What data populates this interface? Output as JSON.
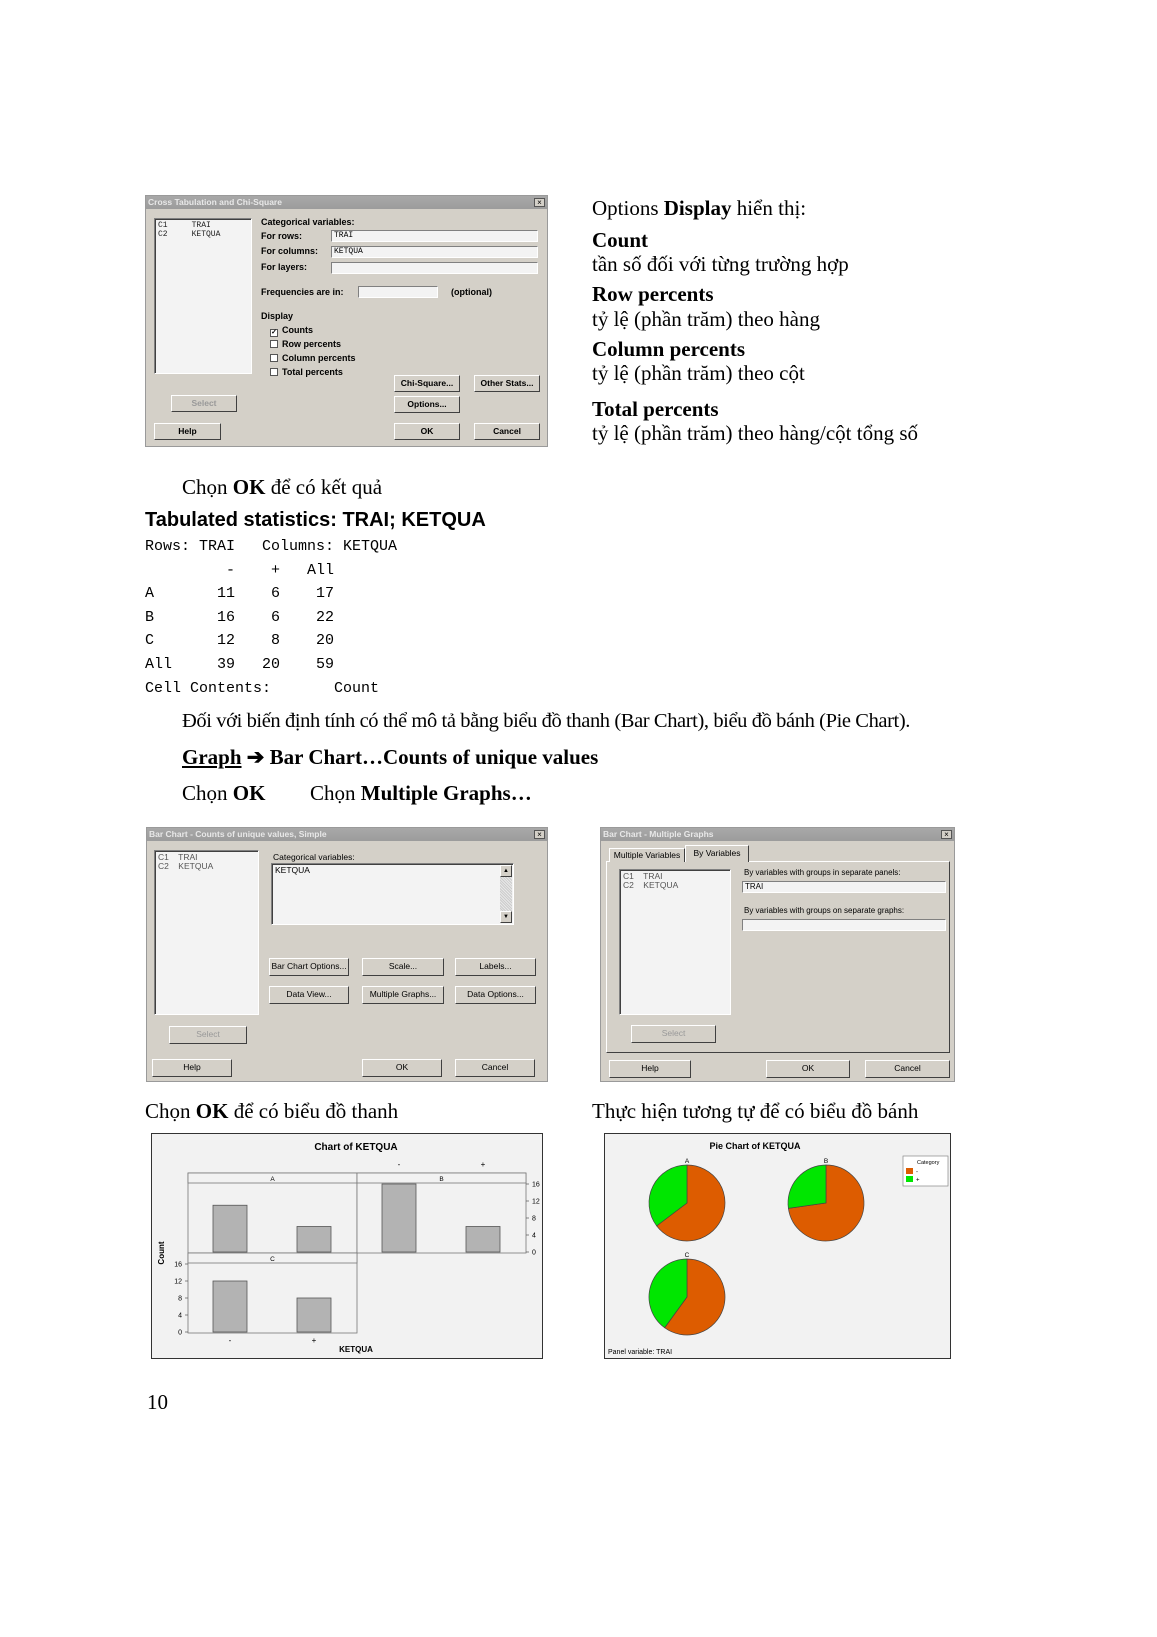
{
  "dialog_crosstab": {
    "title": "Cross Tabulation and Chi-Square",
    "columns_list": "C1     TRAI\nC2     KETQUA",
    "categorical_label": "Categorical variables:",
    "for_rows_label": "For rows:",
    "for_rows_value": "TRAI",
    "for_columns_label": "For columns:",
    "for_columns_value": "KETQUA",
    "for_layers_label": "For layers:",
    "for_layers_value": "",
    "frequencies_label": "Frequencies are in:",
    "frequencies_value": "",
    "optional_label": "(optional)",
    "display_label": "Display",
    "display_options": [
      {
        "label": "Counts",
        "checked": true
      },
      {
        "label": "Row percents",
        "checked": false
      },
      {
        "label": "Column percents",
        "checked": false
      },
      {
        "label": "Total percents",
        "checked": false
      }
    ],
    "buttons": {
      "chi_square": "Chi-Square...",
      "other_stats": "Other Stats...",
      "options": "Options...",
      "select": "Select",
      "help": "Help",
      "ok": "OK",
      "cancel": "Cancel"
    }
  },
  "options_text": {
    "intro_plain": "Options ",
    "intro_bold": "Display",
    "intro_rest": " hiển thị:",
    "items": [
      {
        "term": "Count",
        "desc": "tần số đối với từng trường hợp"
      },
      {
        "term": "Row percents",
        "desc": "tỷ lệ (phần trăm) theo hàng"
      },
      {
        "term": "Column percents",
        "desc": "tỷ lệ (phần trăm) theo cột"
      },
      {
        "term": "Total percents",
        "desc": "tỷ lệ (phần trăm) theo hàng/cột tổng số"
      }
    ]
  },
  "choose_ok": {
    "pre": "Chọn ",
    "bold": "OK",
    "post": " để có kết quả"
  },
  "output": {
    "heading": "Tabulated statistics: TRAI; KETQUA",
    "lines": [
      "Rows: TRAI   Columns: KETQUA",
      "         -    +   All",
      "A       11    6    17",
      "B       16    6    22",
      "C       12    8    20",
      "All     39   20    59",
      "Cell Contents:       Count"
    ]
  },
  "para1": "Đối với biến định tính có thể mô tả bằng biểu đồ thanh (Bar Chart), biểu đồ bánh (Pie Chart).",
  "menu_path": {
    "graph": "Graph",
    "arrow": "➔",
    "bar_chart": "Bar Chart…Counts of unique values"
  },
  "choose_line": {
    "pre1": "Chọn ",
    "bold1": "OK",
    "pre2": "Chọn ",
    "bold2": "Multiple Graphs…"
  },
  "dialog_barchart": {
    "title": "Bar Chart - Counts of unique values, Simple",
    "columns_list": "C1    TRAI\nC2    KETQUA",
    "categorical_label": "Categorical variables:",
    "categorical_value": "KETQUA",
    "buttons": {
      "bar_chart_options": "Bar Chart Options...",
      "scale": "Scale...",
      "labels": "Labels...",
      "data_view": "Data View...",
      "multiple_graphs": "Multiple Graphs...",
      "data_options": "Data Options...",
      "select": "Select",
      "help": "Help",
      "ok": "OK",
      "cancel": "Cancel"
    }
  },
  "dialog_multiple": {
    "title": "Bar Chart - Multiple Graphs",
    "tabs": [
      "Multiple Variables",
      "By Variables"
    ],
    "active_tab": "By Variables",
    "columns_list": "C1    TRAI\nC2    KETQUA",
    "panels_label": "By variables with groups in separate panels:",
    "panels_value": "TRAI",
    "graphs_label": "By variables with groups on separate graphs:",
    "graphs_value": "",
    "buttons": {
      "select": "Select",
      "help": "Help",
      "ok": "OK",
      "cancel": "Cancel"
    }
  },
  "caption_bar": {
    "pre": "Chọn ",
    "bold": "OK",
    "post": " để có biểu đồ thanh"
  },
  "caption_pie": "Thực hiện tương tự để có biểu đồ bánh",
  "chart_data": [
    {
      "type": "bar",
      "title": "Chart of KETQUA",
      "xlabel": "KETQUA",
      "ylabel": "Count",
      "categories": [
        "-",
        "+"
      ],
      "panels": [
        "A",
        "B",
        "C"
      ],
      "values": {
        "A": [
          11,
          6
        ],
        "B": [
          16,
          6
        ],
        "C": [
          12,
          8
        ]
      },
      "yticks": [
        0,
        4,
        8,
        12,
        16
      ],
      "ylim": [
        0,
        16
      ],
      "bar_color": "#b3b3b3",
      "grid": false
    },
    {
      "type": "pie",
      "title": "Pie Chart of KETQUA",
      "panels": [
        "A",
        "B",
        "C"
      ],
      "categories": [
        "-",
        "+"
      ],
      "values": {
        "A": [
          11,
          6
        ],
        "B": [
          16,
          6
        ],
        "C": [
          12,
          8
        ]
      },
      "colors": [
        "#dd5c00",
        "#00e600"
      ],
      "legend_title": "Category",
      "legend_position": "top-right",
      "footnote": "Panel variable: TRAI"
    }
  ],
  "page_number": "10"
}
